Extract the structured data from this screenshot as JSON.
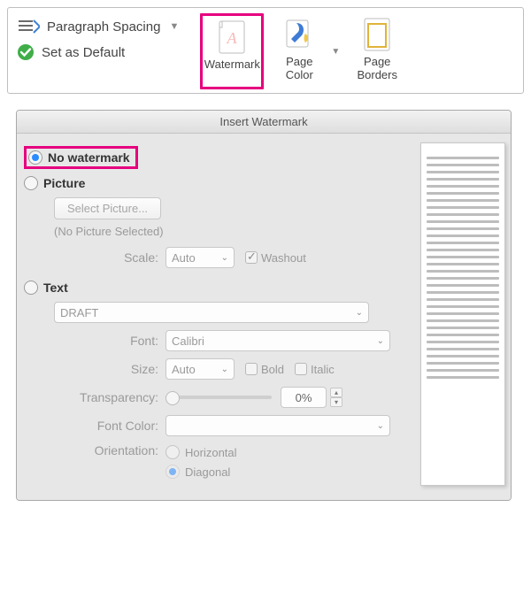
{
  "ribbon": {
    "paragraph_spacing": "Paragraph Spacing",
    "set_default": "Set as Default",
    "watermark": "Watermark",
    "page_color": "Page Color",
    "page_borders": "Page Borders"
  },
  "dialog": {
    "title": "Insert Watermark",
    "options": {
      "no_watermark": "No watermark",
      "picture": "Picture",
      "text": "Text"
    },
    "picture": {
      "select_btn": "Select Picture...",
      "status": "(No Picture Selected)",
      "scale_label": "Scale:",
      "scale_value": "Auto",
      "washout": "Washout"
    },
    "text": {
      "value": "DRAFT",
      "font_label": "Font:",
      "font_value": "Calibri",
      "size_label": "Size:",
      "size_value": "Auto",
      "bold": "Bold",
      "italic": "Italic",
      "transparency_label": "Transparency:",
      "transparency_value": "0%",
      "font_color_label": "Font Color:",
      "orientation_label": "Orientation:",
      "orientation_h": "Horizontal",
      "orientation_d": "Diagonal"
    }
  }
}
